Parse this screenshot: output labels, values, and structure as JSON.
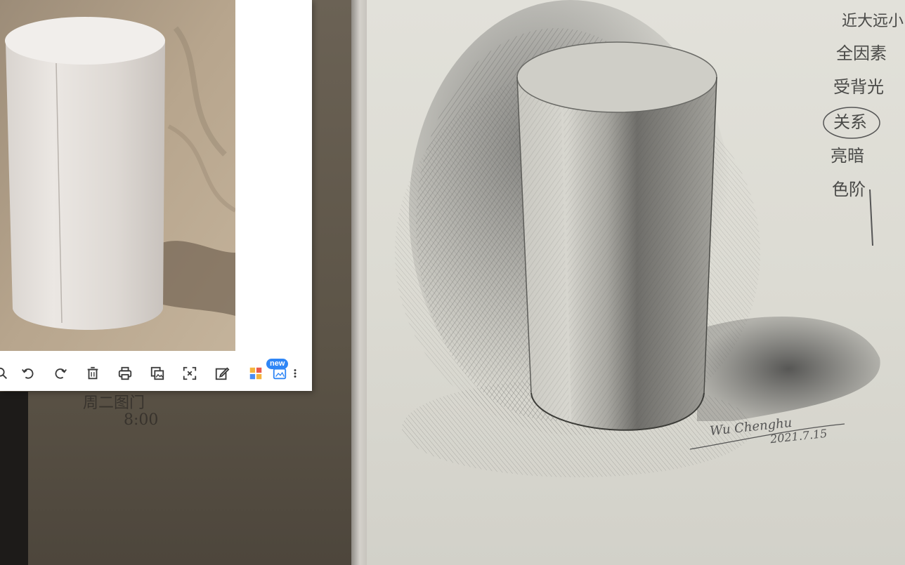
{
  "viewer": {
    "badge": "new",
    "toolbar": [
      {
        "name": "zoom-out-icon"
      },
      {
        "name": "rotate-left-icon"
      },
      {
        "name": "rotate-right-icon"
      },
      {
        "name": "delete-icon"
      },
      {
        "name": "print-icon"
      },
      {
        "name": "copy-image-icon"
      },
      {
        "name": "crop-icon"
      },
      {
        "name": "edit-icon"
      },
      {
        "name": "apps-icon"
      },
      {
        "name": "image-tool-icon"
      },
      {
        "name": "more-menu-icon"
      }
    ]
  },
  "drawing": {
    "notes": [
      "近大远小",
      "全因素",
      "受背光",
      "关系",
      "亮暗",
      "色阶"
    ],
    "signature": "Wu Chenghu",
    "date": "2021.7.15"
  },
  "board": {
    "writing_line1": "周二图门",
    "writing_line2": "8:00"
  },
  "colors": {
    "accent": "#2f86f6",
    "toolbar_icon": "#3a3a3a",
    "paper": "#dcdbd3"
  }
}
